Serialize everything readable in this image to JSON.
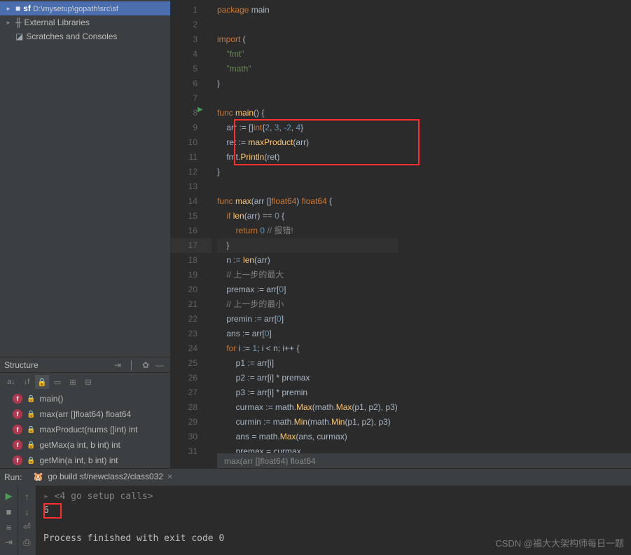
{
  "sidebar": {
    "project": {
      "name": "sf",
      "path": "D:\\mysetup\\gopath\\src\\sf"
    },
    "libs": "External Libraries",
    "scratches": "Scratches and Consoles"
  },
  "structure": {
    "title": "Structure",
    "functions": [
      {
        "name": "main()"
      },
      {
        "name": "max(arr []float64) float64"
      },
      {
        "name": "maxProduct(nums []int) int"
      },
      {
        "name": "getMax(a int, b int) int"
      },
      {
        "name": "getMin(a int, b int) int"
      }
    ]
  },
  "code": {
    "lines": [
      [
        [
          "k",
          "package"
        ],
        [
          " "
        ],
        [
          "t",
          "main"
        ]
      ],
      [],
      [
        [
          "k",
          "import"
        ],
        [
          " ("
        ]
      ],
      [
        [
          "t",
          "    "
        ],
        [
          "s",
          "\"fmt\""
        ]
      ],
      [
        [
          "t",
          "    "
        ],
        [
          "s",
          "\"math\""
        ]
      ],
      [
        [
          "t",
          ")"
        ]
      ],
      [],
      [
        [
          "k",
          "func"
        ],
        [
          " "
        ],
        [
          "fn",
          "main"
        ],
        [
          "t",
          "() {"
        ]
      ],
      [
        [
          "t",
          "    arr "
        ],
        [
          "op",
          ":="
        ],
        [
          "t",
          " []"
        ],
        [
          "k",
          "int"
        ],
        [
          "t",
          "{"
        ],
        [
          "n",
          "2"
        ],
        [
          "t",
          ", "
        ],
        [
          "n",
          "3"
        ],
        [
          "t",
          ", "
        ],
        [
          "n",
          "-2"
        ],
        [
          "t",
          ", "
        ],
        [
          "n",
          "4"
        ],
        [
          "t",
          "}"
        ]
      ],
      [
        [
          "t",
          "    ret "
        ],
        [
          "op",
          ":="
        ],
        [
          "t",
          " "
        ],
        [
          "fn",
          "maxProduct"
        ],
        [
          "t",
          "(arr)"
        ]
      ],
      [
        [
          "t",
          "    fmt"
        ],
        [
          "dot",
          "."
        ],
        [
          "fn",
          "Println"
        ],
        [
          "t",
          "(ret)"
        ]
      ],
      [
        [
          "t",
          "}"
        ]
      ],
      [],
      [
        [
          "k",
          "func"
        ],
        [
          " "
        ],
        [
          "fn",
          "max"
        ],
        [
          "t",
          "(arr []"
        ],
        [
          "k",
          "float64"
        ],
        [
          "t",
          ") "
        ],
        [
          "k",
          "float64"
        ],
        [
          "t",
          " {"
        ]
      ],
      [
        [
          "t",
          "    "
        ],
        [
          "k",
          "if"
        ],
        [
          " "
        ],
        [
          "fn",
          "len"
        ],
        [
          "t",
          "(arr) "
        ],
        [
          "op",
          "=="
        ],
        [
          "t",
          " "
        ],
        [
          "n",
          "0"
        ],
        [
          "t",
          " {"
        ]
      ],
      [
        [
          "t",
          "        "
        ],
        [
          "k",
          "return"
        ],
        [
          "t",
          " "
        ],
        [
          "n",
          "0"
        ],
        [
          "t",
          " "
        ],
        [
          "c",
          "// 报错!"
        ]
      ],
      [
        [
          "t",
          "    }"
        ]
      ],
      [
        [
          "t",
          "    n "
        ],
        [
          "op",
          ":="
        ],
        [
          "t",
          " "
        ],
        [
          "fn",
          "len"
        ],
        [
          "t",
          "(arr)"
        ]
      ],
      [
        [
          "t",
          "    "
        ],
        [
          "c",
          "// 上一步的最大"
        ]
      ],
      [
        [
          "t",
          "    "
        ],
        [
          "t",
          "premax "
        ],
        [
          "op",
          ":="
        ],
        [
          "t",
          " arr["
        ],
        [
          "n",
          "0"
        ],
        [
          "t",
          "]"
        ]
      ],
      [
        [
          "t",
          "    "
        ],
        [
          "c",
          "// 上一步的最小"
        ]
      ],
      [
        [
          "t",
          "    "
        ],
        [
          "t",
          "premin "
        ],
        [
          "op",
          ":="
        ],
        [
          "t",
          " arr["
        ],
        [
          "n",
          "0"
        ],
        [
          "t",
          "]"
        ]
      ],
      [
        [
          "t",
          "    "
        ],
        [
          "t",
          "ans "
        ],
        [
          "op",
          ":="
        ],
        [
          "t",
          " arr["
        ],
        [
          "n",
          "0"
        ],
        [
          "t",
          "]"
        ]
      ],
      [
        [
          "t",
          "    "
        ],
        [
          "k",
          "for"
        ],
        [
          "t",
          " i "
        ],
        [
          "op",
          ":="
        ],
        [
          "t",
          " "
        ],
        [
          "n",
          "1"
        ],
        [
          "t",
          "; i < n; i++ {"
        ]
      ],
      [
        [
          "t",
          "        p1 "
        ],
        [
          "op",
          ":="
        ],
        [
          "t",
          " arr[i]"
        ]
      ],
      [
        [
          "t",
          "        p2 "
        ],
        [
          "op",
          ":="
        ],
        [
          "t",
          " arr[i] * premax"
        ]
      ],
      [
        [
          "t",
          "        p3 "
        ],
        [
          "op",
          ":="
        ],
        [
          "t",
          " arr[i] * premin"
        ]
      ],
      [
        [
          "t",
          "        "
        ],
        [
          "t",
          "curmax "
        ],
        [
          "op",
          ":="
        ],
        [
          "t",
          " math"
        ],
        [
          "dot",
          "."
        ],
        [
          "fn",
          "Max"
        ],
        [
          "t",
          "(math"
        ],
        [
          "dot",
          "."
        ],
        [
          "fn",
          "Max"
        ],
        [
          "t",
          "(p1, p2), p3)"
        ]
      ],
      [
        [
          "t",
          "        "
        ],
        [
          "t",
          "curmin "
        ],
        [
          "op",
          ":="
        ],
        [
          "t",
          " math"
        ],
        [
          "dot",
          "."
        ],
        [
          "fn",
          "Min"
        ],
        [
          "t",
          "(math"
        ],
        [
          "dot",
          "."
        ],
        [
          "fn",
          "Min"
        ],
        [
          "t",
          "(p1, p2), p3)"
        ]
      ],
      [
        [
          "t",
          "        ans = math"
        ],
        [
          "dot",
          "."
        ],
        [
          "fn",
          "Max"
        ],
        [
          "t",
          "(ans, curmax)"
        ]
      ],
      [
        [
          "t",
          "        premax = curmax"
        ]
      ]
    ],
    "breadcrumb": "max(arr []float64) float64"
  },
  "run": {
    "label": "Run:",
    "tab": "go build sf/newclass2/class032",
    "setup_calls": "<4 go setup calls>",
    "output": "6",
    "exit": "Process finished with exit code 0"
  },
  "watermark": "CSDN @福大大架构师每日一题"
}
